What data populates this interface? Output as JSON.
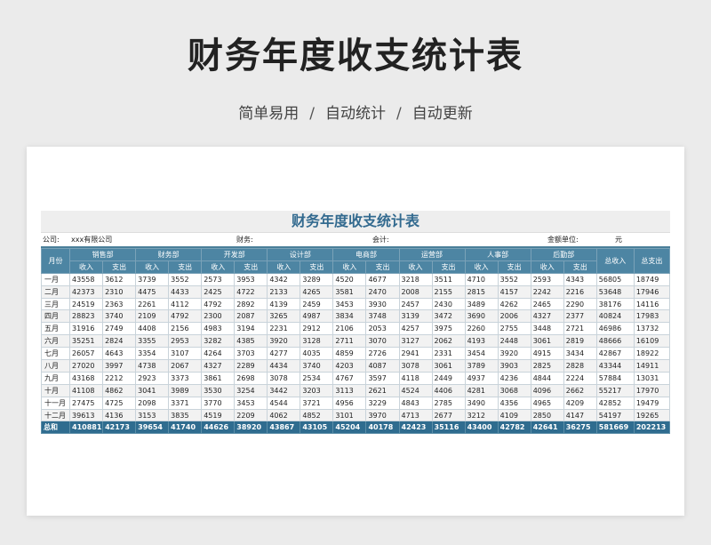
{
  "page": {
    "title": "财务年度收支统计表",
    "subtitle": [
      "简单易用",
      "自动统计",
      "自动更新"
    ],
    "subtitle_sep": "/"
  },
  "sheet": {
    "title": "财务年度收支统计表",
    "info": {
      "company_label": "公司:",
      "company_value": "xxx有限公司",
      "finance_label": "财务:",
      "accountant_label": "会计:",
      "unit_label": "金额单位:",
      "unit_value": "元"
    },
    "header": {
      "month": "月份",
      "departments": [
        "销售部",
        "财务部",
        "开发部",
        "设计部",
        "电商部",
        "运营部",
        "人事部",
        "后勤部"
      ],
      "income": "收入",
      "expense": "支出",
      "total_income": "总收入",
      "total_expense": "总支出"
    },
    "rows": [
      {
        "month": "一月",
        "values": [
          "43558",
          "3612",
          "3739",
          "3552",
          "2573",
          "3953",
          "4342",
          "3289",
          "4520",
          "4677",
          "3218",
          "3511",
          "4710",
          "3552",
          "2593",
          "4343",
          "56805",
          "18749"
        ]
      },
      {
        "month": "二月",
        "values": [
          "42373",
          "2310",
          "4475",
          "4433",
          "2425",
          "4722",
          "2133",
          "4265",
          "3581",
          "2470",
          "2008",
          "2155",
          "2815",
          "4157",
          "2242",
          "2216",
          "53648",
          "17946"
        ]
      },
      {
        "month": "三月",
        "values": [
          "24519",
          "2363",
          "2261",
          "4112",
          "4792",
          "2892",
          "4139",
          "2459",
          "3453",
          "3930",
          "2457",
          "2430",
          "3489",
          "4262",
          "2465",
          "2290",
          "38176",
          "14116"
        ]
      },
      {
        "month": "四月",
        "values": [
          "28823",
          "3740",
          "2109",
          "4792",
          "2300",
          "2087",
          "3265",
          "4987",
          "3834",
          "3748",
          "3139",
          "3472",
          "3690",
          "2006",
          "4327",
          "2377",
          "40824",
          "17983"
        ]
      },
      {
        "month": "五月",
        "values": [
          "31916",
          "2749",
          "4408",
          "2156",
          "4983",
          "3194",
          "2231",
          "2912",
          "2106",
          "2053",
          "4257",
          "3975",
          "2260",
          "2755",
          "3448",
          "2721",
          "46986",
          "13732"
        ]
      },
      {
        "month": "六月",
        "values": [
          "35251",
          "2824",
          "3355",
          "2953",
          "3282",
          "4385",
          "3920",
          "3128",
          "2711",
          "3070",
          "3127",
          "2062",
          "4193",
          "2448",
          "3061",
          "2819",
          "48666",
          "16109"
        ]
      },
      {
        "month": "七月",
        "values": [
          "26057",
          "4643",
          "3354",
          "3107",
          "4264",
          "3703",
          "4277",
          "4035",
          "4859",
          "2726",
          "2941",
          "2331",
          "3454",
          "3920",
          "4915",
          "3434",
          "42867",
          "18922"
        ]
      },
      {
        "month": "八月",
        "values": [
          "27020",
          "3997",
          "4738",
          "2067",
          "4327",
          "2289",
          "4434",
          "3740",
          "4203",
          "4087",
          "3078",
          "3061",
          "3789",
          "3903",
          "2825",
          "2828",
          "43344",
          "14911"
        ]
      },
      {
        "month": "九月",
        "values": [
          "43168",
          "2212",
          "2923",
          "3373",
          "3861",
          "2698",
          "3078",
          "2534",
          "4767",
          "3597",
          "4118",
          "2449",
          "4937",
          "4236",
          "4844",
          "2224",
          "57884",
          "13031"
        ]
      },
      {
        "month": "十月",
        "values": [
          "41108",
          "4862",
          "3041",
          "3989",
          "3530",
          "3254",
          "3442",
          "3203",
          "3113",
          "2621",
          "4524",
          "4406",
          "4281",
          "3068",
          "4096",
          "2662",
          "55217",
          "17970"
        ]
      },
      {
        "month": "十一月",
        "values": [
          "27475",
          "4725",
          "2098",
          "3371",
          "3770",
          "3453",
          "4544",
          "3721",
          "4956",
          "3229",
          "4843",
          "2785",
          "3490",
          "4356",
          "4965",
          "4209",
          "42852",
          "19479"
        ]
      },
      {
        "month": "十二月",
        "values": [
          "39613",
          "4136",
          "3153",
          "3835",
          "4519",
          "2209",
          "4062",
          "4852",
          "3101",
          "3970",
          "4713",
          "2677",
          "3212",
          "4109",
          "2850",
          "4147",
          "54197",
          "19265"
        ]
      }
    ],
    "total": {
      "label": "总和",
      "values": [
        "410881",
        "42173",
        "39654",
        "41740",
        "44626",
        "38920",
        "43867",
        "43105",
        "45204",
        "40178",
        "42423",
        "35116",
        "43400",
        "42782",
        "42641",
        "36275",
        "581669",
        "202213"
      ]
    }
  },
  "colors": {
    "header_bg": "#4d85a3",
    "total_bg": "#2f6c8f",
    "title_text": "#336a8f"
  }
}
